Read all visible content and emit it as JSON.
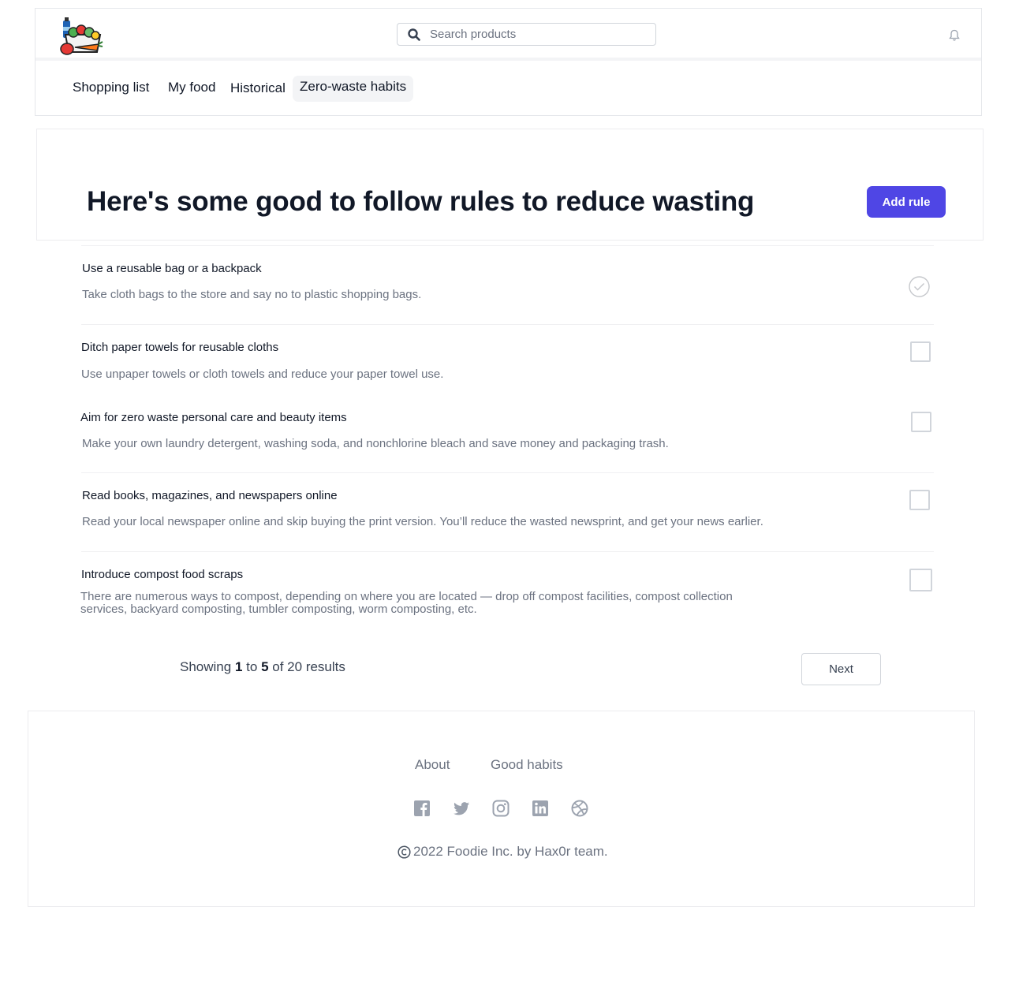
{
  "header": {
    "search_placeholder": "Search products",
    "tabs": [
      {
        "label": "Shopping list"
      },
      {
        "label": "My food"
      },
      {
        "label": "Historical"
      },
      {
        "label": "Zero-waste habits"
      }
    ],
    "active_tab": "Zero-waste habits"
  },
  "hero": {
    "title": "Here's some good to follow rules to reduce wasting",
    "add_button": "Add rule"
  },
  "rules": [
    {
      "title": "Use a reusable bag or a backpack",
      "description": "Take cloth bags to the store and say no to plastic shopping bags.",
      "completed": true
    },
    {
      "title": "Ditch paper towels for reusable cloths",
      "description": "Use unpaper towels or cloth towels and reduce your paper towel use.",
      "completed": false
    },
    {
      "title": "Aim for zero waste personal care and beauty items",
      "description": "Make your own laundry detergent, washing soda, and nonchlorine bleach and save money and packaging trash.",
      "completed": false
    },
    {
      "title": "Read books, magazines, and newspapers online",
      "description": "Read your local newspaper online and skip buying the print version. You’ll reduce the wasted newsprint, and get your news earlier.",
      "completed": false
    },
    {
      "title": "Introduce compost food scraps",
      "description": "There are numerous ways to compost, depending on where you are located — drop off compost facilities, compost collection services, backyard composting, tumbler composting, worm composting, etc.",
      "completed": false
    }
  ],
  "pagination": {
    "showing_prefix": "Showing",
    "from": "1",
    "to_word": "to",
    "to": "5",
    "of_text": "of 20 results",
    "next_label": "Next"
  },
  "footer": {
    "links": [
      {
        "label": "About"
      },
      {
        "label": "Good habits"
      }
    ],
    "social_icons": [
      "facebook-icon",
      "twitter-icon",
      "instagram-icon",
      "linkedin-icon",
      "dribbble-icon"
    ],
    "copyright": "2022 Foodie Inc.  by Hax0r team."
  },
  "colors": {
    "accent": "#4f46e5",
    "muted_text": "#6b7280",
    "border": "#e5e7eb"
  }
}
